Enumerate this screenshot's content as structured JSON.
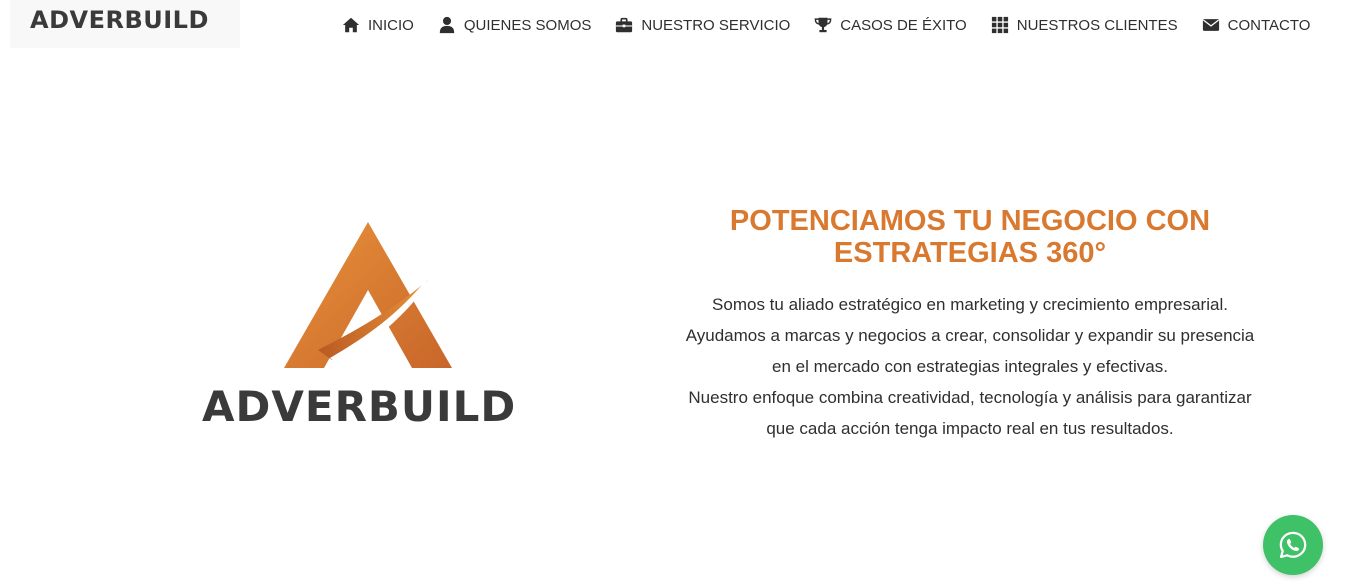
{
  "header": {
    "brand": "ADVERBUILD",
    "nav": [
      {
        "label": "INICIO",
        "icon": "home-icon"
      },
      {
        "label": "QUIENES SOMOS",
        "icon": "user-icon"
      },
      {
        "label": "NUESTRO SERVICIO",
        "icon": "briefcase-icon"
      },
      {
        "label": "CASOS DE ÉXITO",
        "icon": "trophy-icon"
      },
      {
        "label": "NUESTROS CLIENTES",
        "icon": "grid-icon"
      },
      {
        "label": "CONTACTO",
        "icon": "envelope-icon"
      }
    ]
  },
  "hero": {
    "logo_word": "ADVERBUILD",
    "title": "POTENCIAMOS TU NEGOCIO CON ESTRATEGIAS 360°",
    "paragraph": [
      "Somos tu aliado estratégico en marketing y crecimiento empresarial.",
      "Ayudamos a marcas y negocios a crear, consolidar y expandir su presencia",
      "en el mercado con estrategias integrales y efectivas.",
      "Nuestro enfoque combina creatividad, tecnología y análisis para garantizar",
      "que cada acción tenga impacto real en tus resultados."
    ]
  },
  "whatsapp": {
    "icon": "whatsapp-icon"
  },
  "colors": {
    "accent": "#d9782f",
    "text": "#2f2f2f",
    "whatsapp": "#3fc168"
  }
}
